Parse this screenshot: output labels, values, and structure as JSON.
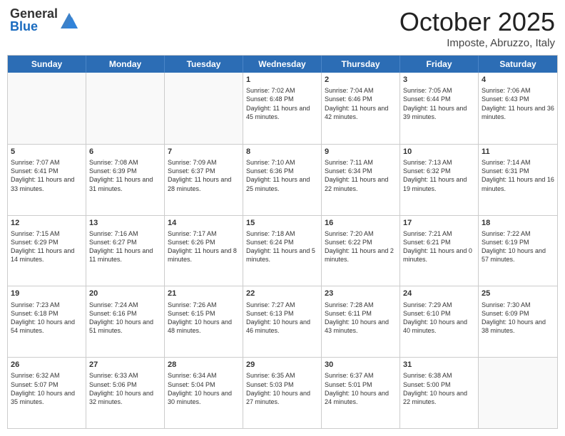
{
  "logo": {
    "general": "General",
    "blue": "Blue"
  },
  "title": "October 2025",
  "location": "Imposte, Abruzzo, Italy",
  "header_days": [
    "Sunday",
    "Monday",
    "Tuesday",
    "Wednesday",
    "Thursday",
    "Friday",
    "Saturday"
  ],
  "weeks": [
    [
      {
        "day": "",
        "info": ""
      },
      {
        "day": "",
        "info": ""
      },
      {
        "day": "",
        "info": ""
      },
      {
        "day": "1",
        "info": "Sunrise: 7:02 AM\nSunset: 6:48 PM\nDaylight: 11 hours and 45 minutes."
      },
      {
        "day": "2",
        "info": "Sunrise: 7:04 AM\nSunset: 6:46 PM\nDaylight: 11 hours and 42 minutes."
      },
      {
        "day": "3",
        "info": "Sunrise: 7:05 AM\nSunset: 6:44 PM\nDaylight: 11 hours and 39 minutes."
      },
      {
        "day": "4",
        "info": "Sunrise: 7:06 AM\nSunset: 6:43 PM\nDaylight: 11 hours and 36 minutes."
      }
    ],
    [
      {
        "day": "5",
        "info": "Sunrise: 7:07 AM\nSunset: 6:41 PM\nDaylight: 11 hours and 33 minutes."
      },
      {
        "day": "6",
        "info": "Sunrise: 7:08 AM\nSunset: 6:39 PM\nDaylight: 11 hours and 31 minutes."
      },
      {
        "day": "7",
        "info": "Sunrise: 7:09 AM\nSunset: 6:37 PM\nDaylight: 11 hours and 28 minutes."
      },
      {
        "day": "8",
        "info": "Sunrise: 7:10 AM\nSunset: 6:36 PM\nDaylight: 11 hours and 25 minutes."
      },
      {
        "day": "9",
        "info": "Sunrise: 7:11 AM\nSunset: 6:34 PM\nDaylight: 11 hours and 22 minutes."
      },
      {
        "day": "10",
        "info": "Sunrise: 7:13 AM\nSunset: 6:32 PM\nDaylight: 11 hours and 19 minutes."
      },
      {
        "day": "11",
        "info": "Sunrise: 7:14 AM\nSunset: 6:31 PM\nDaylight: 11 hours and 16 minutes."
      }
    ],
    [
      {
        "day": "12",
        "info": "Sunrise: 7:15 AM\nSunset: 6:29 PM\nDaylight: 11 hours and 14 minutes."
      },
      {
        "day": "13",
        "info": "Sunrise: 7:16 AM\nSunset: 6:27 PM\nDaylight: 11 hours and 11 minutes."
      },
      {
        "day": "14",
        "info": "Sunrise: 7:17 AM\nSunset: 6:26 PM\nDaylight: 11 hours and 8 minutes."
      },
      {
        "day": "15",
        "info": "Sunrise: 7:18 AM\nSunset: 6:24 PM\nDaylight: 11 hours and 5 minutes."
      },
      {
        "day": "16",
        "info": "Sunrise: 7:20 AM\nSunset: 6:22 PM\nDaylight: 11 hours and 2 minutes."
      },
      {
        "day": "17",
        "info": "Sunrise: 7:21 AM\nSunset: 6:21 PM\nDaylight: 11 hours and 0 minutes."
      },
      {
        "day": "18",
        "info": "Sunrise: 7:22 AM\nSunset: 6:19 PM\nDaylight: 10 hours and 57 minutes."
      }
    ],
    [
      {
        "day": "19",
        "info": "Sunrise: 7:23 AM\nSunset: 6:18 PM\nDaylight: 10 hours and 54 minutes."
      },
      {
        "day": "20",
        "info": "Sunrise: 7:24 AM\nSunset: 6:16 PM\nDaylight: 10 hours and 51 minutes."
      },
      {
        "day": "21",
        "info": "Sunrise: 7:26 AM\nSunset: 6:15 PM\nDaylight: 10 hours and 48 minutes."
      },
      {
        "day": "22",
        "info": "Sunrise: 7:27 AM\nSunset: 6:13 PM\nDaylight: 10 hours and 46 minutes."
      },
      {
        "day": "23",
        "info": "Sunrise: 7:28 AM\nSunset: 6:11 PM\nDaylight: 10 hours and 43 minutes."
      },
      {
        "day": "24",
        "info": "Sunrise: 7:29 AM\nSunset: 6:10 PM\nDaylight: 10 hours and 40 minutes."
      },
      {
        "day": "25",
        "info": "Sunrise: 7:30 AM\nSunset: 6:09 PM\nDaylight: 10 hours and 38 minutes."
      }
    ],
    [
      {
        "day": "26",
        "info": "Sunrise: 6:32 AM\nSunset: 5:07 PM\nDaylight: 10 hours and 35 minutes."
      },
      {
        "day": "27",
        "info": "Sunrise: 6:33 AM\nSunset: 5:06 PM\nDaylight: 10 hours and 32 minutes."
      },
      {
        "day": "28",
        "info": "Sunrise: 6:34 AM\nSunset: 5:04 PM\nDaylight: 10 hours and 30 minutes."
      },
      {
        "day": "29",
        "info": "Sunrise: 6:35 AM\nSunset: 5:03 PM\nDaylight: 10 hours and 27 minutes."
      },
      {
        "day": "30",
        "info": "Sunrise: 6:37 AM\nSunset: 5:01 PM\nDaylight: 10 hours and 24 minutes."
      },
      {
        "day": "31",
        "info": "Sunrise: 6:38 AM\nSunset: 5:00 PM\nDaylight: 10 hours and 22 minutes."
      },
      {
        "day": "",
        "info": ""
      }
    ]
  ]
}
